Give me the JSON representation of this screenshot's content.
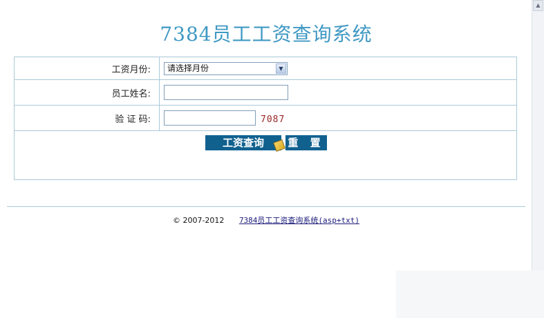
{
  "title": "7384员工工资查询系统",
  "form": {
    "month_label": "工资月份:",
    "month_selected": "请选择月份",
    "name_label": "员工姓名:",
    "name_value": "",
    "code_label": "验 证 码:",
    "code_value": "",
    "captcha_text": "7087"
  },
  "buttons": {
    "query": "工资查询",
    "reset": "重 置"
  },
  "footer": {
    "copyright": "© 2007-2012",
    "link_text": "7384员工工资查询系统(asp+txt)"
  },
  "colors": {
    "title": "#3f98c3",
    "button_bg": "#11618f",
    "border": "#a9c9d8",
    "captcha": "#9b2424"
  }
}
